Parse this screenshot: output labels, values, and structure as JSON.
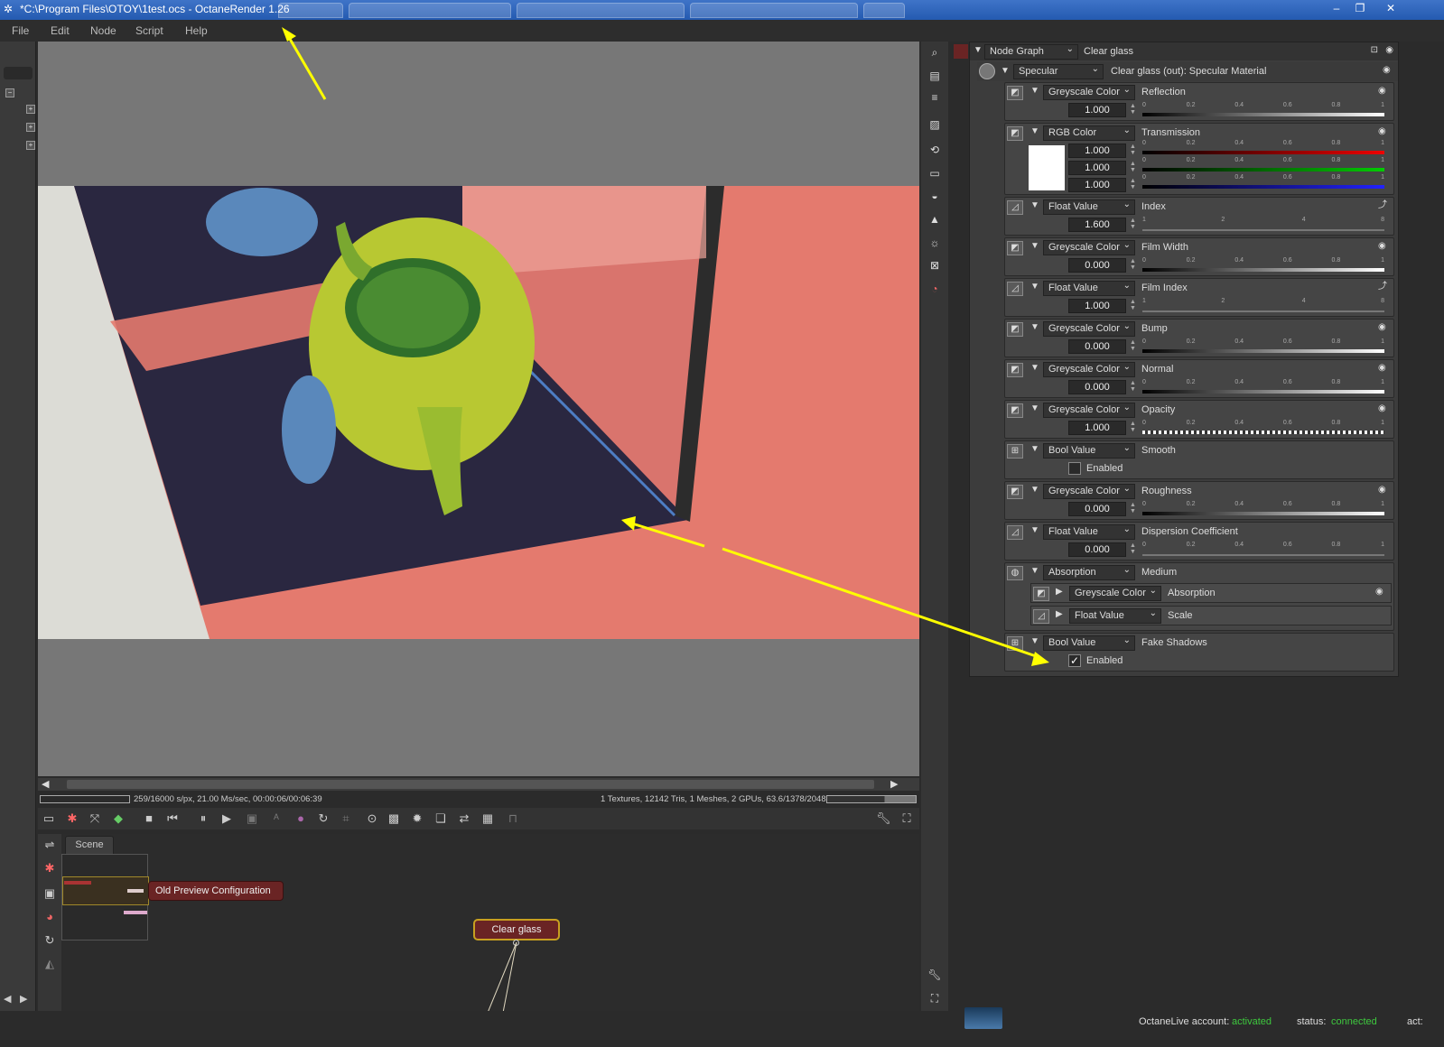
{
  "window": {
    "title": "*C:\\Program Files\\OTOY\\1test.ocs - OctaneRender 1.26"
  },
  "menu": [
    "File",
    "Edit",
    "Node",
    "Script",
    "Help"
  ],
  "viewport": {
    "status_left": "259/16000 s/px, 21.00 Ms/sec, 00:00:06/00:06:39",
    "status_right": "1 Textures, 12142 Tris, 1 Meshes, 2 GPUs, 63.6/1378/2048 MB"
  },
  "graph": {
    "tab": "Scene",
    "node_preview": "Old Preview Configuration",
    "node_material": "Clear glass"
  },
  "panel": {
    "header_type": "Node Graph",
    "header_name": "Clear glass",
    "material_type": "Specular",
    "material_desc": "Clear glass (out):  Specular Material",
    "rows": [
      {
        "type": "Greyscale Color",
        "label": "Reflection",
        "value": "1.000"
      },
      {
        "type": "RGB Color",
        "label": "Transmission",
        "r": "1.000",
        "g": "1.000",
        "b": "1.000"
      },
      {
        "type": "Float Value",
        "label": "Index",
        "value": "1.600"
      },
      {
        "type": "Greyscale Color",
        "label": "Film Width",
        "value": "0.000"
      },
      {
        "type": "Float Value",
        "label": "Film Index",
        "value": "1.000"
      },
      {
        "type": "Greyscale Color",
        "label": "Bump",
        "value": "0.000"
      },
      {
        "type": "Greyscale Color",
        "label": "Normal",
        "value": "0.000"
      },
      {
        "type": "Greyscale Color",
        "label": "Opacity",
        "value": "1.000"
      },
      {
        "type": "Bool Value",
        "label": "Smooth",
        "check_label": "Enabled"
      },
      {
        "type": "Greyscale Color",
        "label": "Roughness",
        "value": "0.000"
      },
      {
        "type": "Float Value",
        "label": "Dispersion Coefficient",
        "value": "0.000"
      },
      {
        "type": "Absorption",
        "label": "Medium"
      },
      {
        "type": "Greyscale Color",
        "label": "Absorption"
      },
      {
        "type": "Float Value",
        "label": "Scale"
      },
      {
        "type": "Bool Value",
        "label": "Fake Shadows",
        "check_label": "Enabled"
      }
    ]
  },
  "ticks": {
    "unit": [
      "0",
      "0.2",
      "0.4",
      "0.6",
      "0.8",
      "1"
    ],
    "index": [
      "1",
      "2",
      "4",
      "8"
    ],
    "disp": [
      "0",
      "0.2",
      "0.4",
      "0.6",
      "0.8",
      "1"
    ]
  },
  "checks": {
    "smooth": false,
    "fake_shadows": true
  },
  "footer": {
    "account_label": "OctaneLive account:",
    "account_value": "activated",
    "status_label": "status:",
    "status_value": "connected",
    "act_label": "act:"
  },
  "colors": {
    "accent_green": "#3ec83e",
    "node_border": "#c8a020"
  }
}
